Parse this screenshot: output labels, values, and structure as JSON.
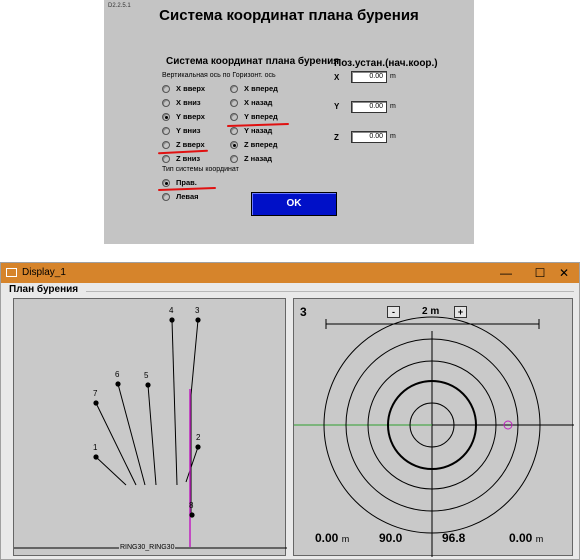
{
  "dialog": {
    "version": "D2.2.5.1",
    "title": "Система координат плана бурения",
    "section_title": "Система координат плана бурения",
    "column_header": "Вертикальная ось по Горизонт. ось",
    "vertical_options": [
      {
        "label": "X вверх",
        "selected": false
      },
      {
        "label": "X вниз",
        "selected": false
      },
      {
        "label": "Y вверх",
        "selected": true
      },
      {
        "label": "Y вниз",
        "selected": false
      },
      {
        "label": "Z вверх",
        "selected": false
      },
      {
        "label": "Z вниз",
        "selected": false
      }
    ],
    "horizontal_options": [
      {
        "label": "X вперед",
        "selected": false
      },
      {
        "label": "X назад",
        "selected": false
      },
      {
        "label": "Y вперед",
        "selected": false
      },
      {
        "label": "Y назад",
        "selected": false
      },
      {
        "label": "Z вперед",
        "selected": true
      },
      {
        "label": "Z назад",
        "selected": false
      }
    ],
    "coord_type_label": "Тип системы координат",
    "coord_type_options": [
      {
        "label": "Прав.",
        "selected": true
      },
      {
        "label": "Левая",
        "selected": false
      }
    ],
    "position_title": "Поз.устан.(нач.коор.)",
    "position_fields": [
      {
        "axis": "X",
        "value": "0.00",
        "unit": "m"
      },
      {
        "axis": "Y",
        "value": "0.00",
        "unit": "m"
      },
      {
        "axis": "Z",
        "value": "0.00",
        "unit": "m"
      }
    ],
    "ok_label": "OK",
    "annotation_color": "#e01010"
  },
  "window": {
    "title": "Display_1",
    "titlebar_color": "#d6842b",
    "minimize": "—",
    "maximize": "☐",
    "close": "✕",
    "group_label": "План бурения"
  },
  "plan": {
    "ring_label": "RING30_RING30",
    "hole_labels": [
      "1",
      "7",
      "6",
      "5",
      "4",
      "3",
      "2",
      "8"
    ],
    "highlight_color": "#c020c0",
    "axis_color": "#30a030"
  },
  "target": {
    "number": "3",
    "minus_label": "-",
    "plus_label": "+",
    "scale_text": "2 m",
    "readouts": [
      {
        "value": "0.00",
        "unit": "m"
      },
      {
        "value": "90.0",
        "unit": ""
      },
      {
        "value": "96.8",
        "unit": ""
      },
      {
        "value": "0.00",
        "unit": "m"
      }
    ]
  }
}
